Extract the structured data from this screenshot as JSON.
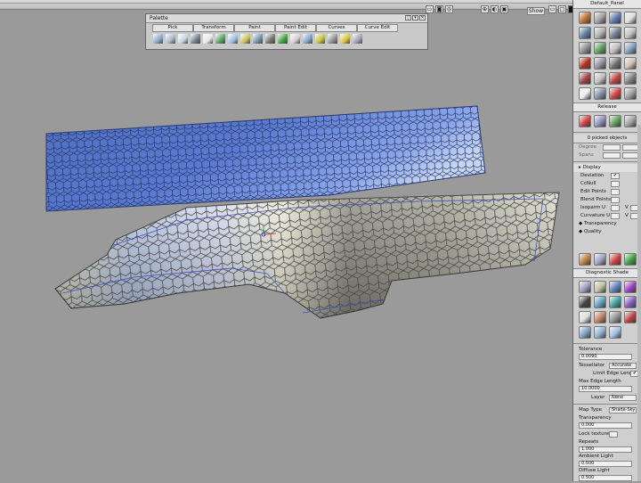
{
  "topbar": {
    "show_label": "Show"
  },
  "palette": {
    "title": "Palette",
    "tabs": [
      "Pick",
      "Transform",
      "Paint",
      "Paint Edit",
      "Curves",
      "Curve Edit"
    ],
    "icon_colors": [
      "#8aa6c8",
      "#a9b6c4",
      "#c8d3de",
      "#6f7c8c",
      "#e6e6e6",
      "#58a060",
      "#9fc0e0",
      "#c8c060",
      "#6f8fa8",
      "#707070",
      "#40a040",
      "#d0d0d0",
      "#80a0c0",
      "#c0c040",
      "#909090",
      "#d8c040",
      "#a0a0b0"
    ]
  },
  "panel": {
    "title": "Default_Panel",
    "grid_colors": [
      "#c07030",
      "#a0a0a0",
      "#5a7ab0",
      "#e0e0e0",
      "#6080a0",
      "#b0b0b0",
      "#708090",
      "#c0c0c0",
      "#909090",
      "#60a060",
      "#c0c0c0",
      "#80a0c0",
      "#b03020",
      "#9090a0",
      "#707070",
      "#d0c0b0",
      "#a04040",
      "#c0c0c0",
      "#c04040",
      "#808080",
      "#f0f0f0",
      "#8090a0",
      "#d04040",
      "#a0a0a0"
    ],
    "release_label": "Release",
    "release_colors": [
      "#d04040",
      "#9090c0",
      "#60a060",
      "#a0a0a0"
    ],
    "picked_objects": "0 picked objects",
    "degree_label": "Degree",
    "spans_label": "Spans",
    "display_label": "Display",
    "display_items": [
      {
        "label": "Deviation",
        "check": "✔"
      },
      {
        "label": "CcNull",
        "check": ""
      },
      {
        "label": "Edit Points",
        "check": ""
      },
      {
        "label": "Blend Points",
        "check": ""
      },
      {
        "label": "Isoparm U",
        "check": ""
      },
      {
        "label": "Curvature U",
        "check": ""
      }
    ],
    "v_label": "V",
    "transparency_label": "Transparency",
    "quality_label": "Quality",
    "tool_colors": [
      "#c08040",
      "#a0a0c0",
      "#d04040",
      "#40a040"
    ],
    "diag_title": "Diagnostic Shade",
    "diag_colors": [
      "#a0a0c0",
      "#c0c0a0",
      "#6080c0",
      "#a040c0",
      "#404040",
      "#60a0c0",
      "#40a0a0",
      "#8060c0",
      "#e0e0e0",
      "#c08060",
      "#909090",
      "#c04040",
      "#80a0c0",
      "#90b0d0",
      "#a0c0e0"
    ],
    "tolerance_label": "Tolerance",
    "tolerance_value": "0.0090",
    "tessellator_label": "Tessellator",
    "tessellator_value": "Accurate",
    "limit_edge_label": "Limit Edge Length",
    "limit_edge_check": "✔",
    "max_edge_label": "Max Edge Length",
    "max_edge_value": "10.0000",
    "layer_label": "Layer",
    "layer_value": "None",
    "map_type_label": "Map Type",
    "map_type_value": "Shade-Sky",
    "transparency2_label": "Transparency",
    "transparency2_value": "0.000",
    "lock_texture_label": "Lock texture",
    "repeats_label": "Repeats",
    "repeats_value": "1.000",
    "ambient_label": "Ambient Light",
    "ambient_value": "0.500",
    "diffuse_label": "Diffuse Light",
    "diffuse_value": "0.500"
  }
}
